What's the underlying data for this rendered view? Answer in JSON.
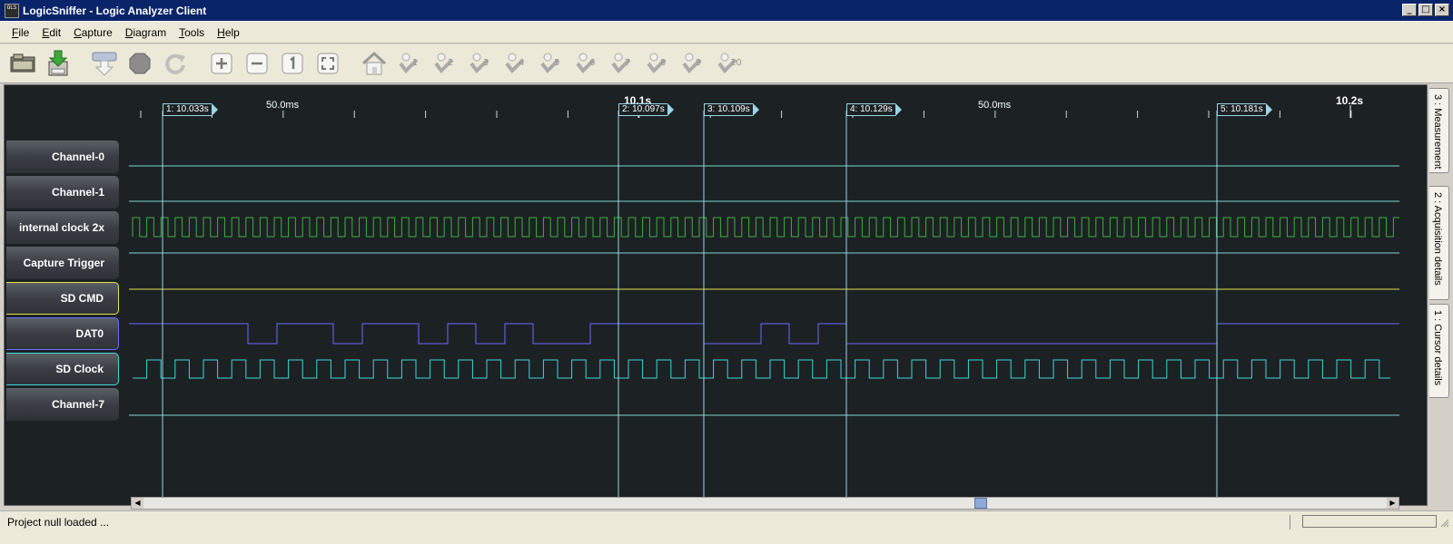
{
  "window": {
    "title": "LogicSniffer - Logic Analyzer Client",
    "icon_text": "OLS",
    "controls": [
      "minimize-icon",
      "maximize-icon",
      "close-icon"
    ]
  },
  "menu": [
    {
      "label": "File",
      "mnemonic": "F",
      "rest": "ile"
    },
    {
      "label": "Edit",
      "mnemonic": "E",
      "rest": "dit"
    },
    {
      "label": "Capture",
      "mnemonic": "C",
      "rest": "apture"
    },
    {
      "label": "Diagram",
      "mnemonic": "D",
      "rest": "iagram"
    },
    {
      "label": "Tools",
      "mnemonic": "T",
      "rest": "ools"
    },
    {
      "label": "Help",
      "mnemonic": "H",
      "rest": "elp"
    }
  ],
  "toolbar": {
    "buttons": [
      "open-icon",
      "save-icon",
      "capture-icon",
      "stop-icon",
      "repeat-capture-icon",
      "zoom-in-icon",
      "zoom-out-icon",
      "zoom-original-icon",
      "zoom-fit-icon",
      "home-icon",
      "goto-cursor-1-icon",
      "goto-cursor-2-icon",
      "goto-cursor-3-icon",
      "goto-cursor-4-icon",
      "goto-cursor-5-icon",
      "goto-cursor-6-icon",
      "goto-cursor-7-icon",
      "goto-cursor-8-icon",
      "goto-cursor-9-icon",
      "goto-cursor-10-icon"
    ],
    "cursor_numbers": [
      "1",
      "2",
      "3",
      "4",
      "5",
      "6",
      "7",
      "8",
      "9",
      "10"
    ]
  },
  "ruler": {
    "labels": [
      "50.0ms",
      "10.1s",
      "50.0ms",
      "10.2s"
    ]
  },
  "cursors": [
    {
      "label": "1: 10.033s"
    },
    {
      "label": "2: 10.097s"
    },
    {
      "label": "3: 10.109s"
    },
    {
      "label": "4: 10.129s"
    },
    {
      "label": "5: 10.181s"
    }
  ],
  "channels": [
    {
      "label": "Channel-0",
      "color": "#7ad7cf"
    },
    {
      "label": "Channel-1",
      "color": "#7ad7cf"
    },
    {
      "label": "internal clock 2x",
      "color": "#3fae3f"
    },
    {
      "label": "Capture Trigger",
      "color": "#7ad7cf"
    },
    {
      "label": "SD CMD",
      "color": "#e6e14a"
    },
    {
      "label": "DAT0",
      "color": "#6b6bff"
    },
    {
      "label": "SD Clock",
      "color": "#3fd6d6"
    },
    {
      "label": "Channel-7",
      "color": "#7ad7cf"
    }
  ],
  "side_tabs": [
    "3 : Measurement",
    "2 : Acquisition details",
    "1 : Cursor details"
  ],
  "status": {
    "text": "Project null loaded ..."
  },
  "colors": {
    "background": "#1c2124",
    "cursor": "#9ad6e6",
    "titlebar": "#0a246a"
  }
}
